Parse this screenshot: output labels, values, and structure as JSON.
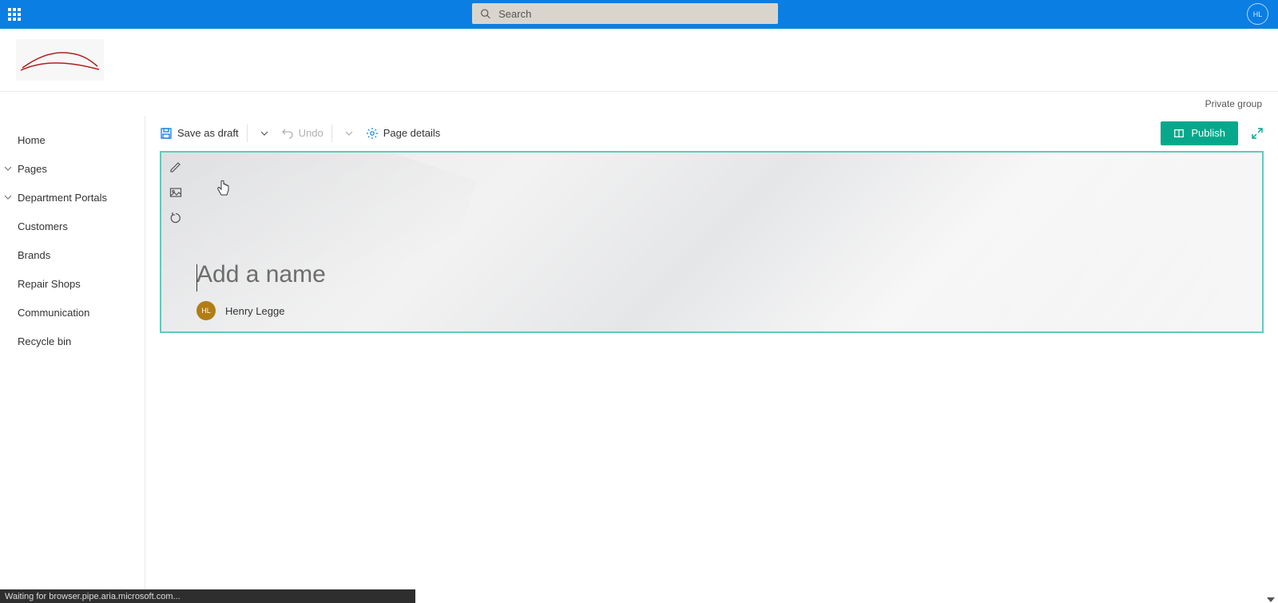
{
  "suite": {
    "search_placeholder": "Search",
    "user_initials": "HL"
  },
  "site": {
    "group_type": "Private group"
  },
  "nav": {
    "home": "Home",
    "pages": "Pages",
    "department_portals": "Department Portals",
    "customers": "Customers",
    "brands": "Brands",
    "repair_shops": "Repair Shops",
    "communication": "Communication",
    "recycle_bin": "Recycle bin"
  },
  "commands": {
    "save_as_draft": "Save as draft",
    "undo": "Undo",
    "page_details": "Page details",
    "publish": "Publish"
  },
  "page": {
    "title_placeholder": "Add a name",
    "author_name": "Henry Legge",
    "author_initials": "HL"
  },
  "status": {
    "text": "Waiting for browser.pipe.aria.microsoft.com..."
  }
}
